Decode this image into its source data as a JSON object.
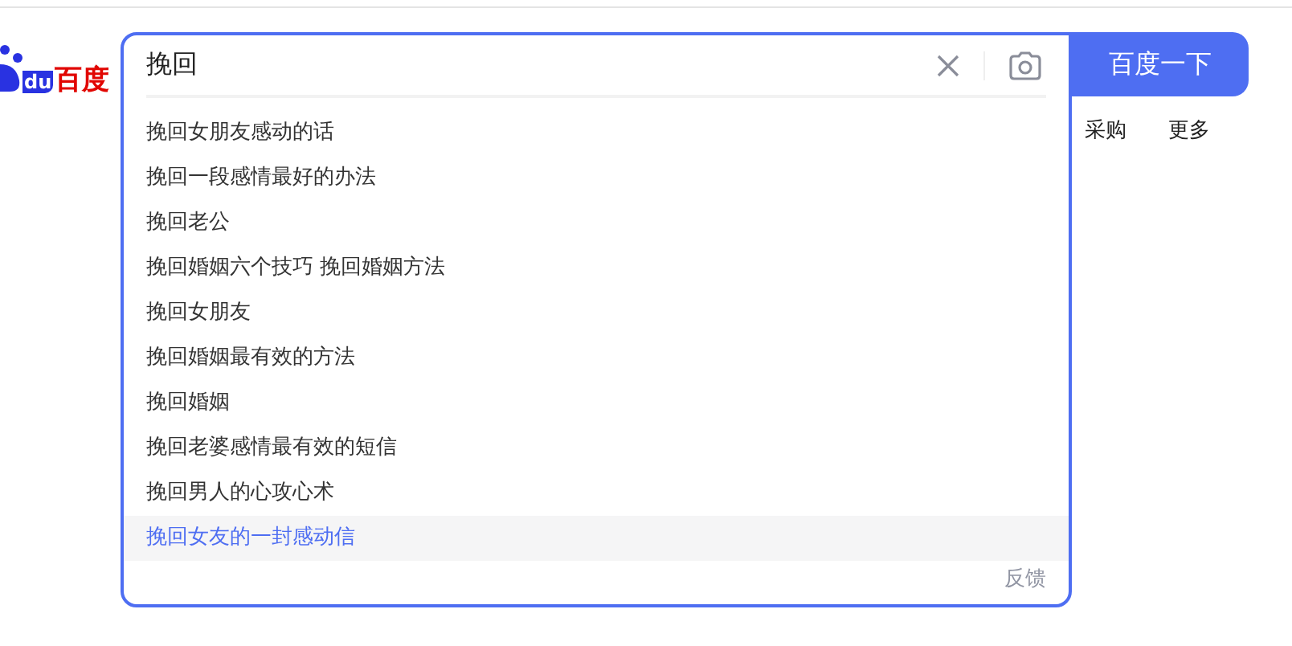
{
  "logo": {
    "mark_text": "du",
    "name": "百度"
  },
  "search": {
    "value": "挽回"
  },
  "suggestions": [
    {
      "text": "挽回女朋友感动的话",
      "selected": false
    },
    {
      "text": "挽回一段感情最好的办法",
      "selected": false
    },
    {
      "text": "挽回老公",
      "selected": false
    },
    {
      "text": "挽回婚姻六个技巧 挽回婚姻方法",
      "selected": false
    },
    {
      "text": "挽回女朋友",
      "selected": false
    },
    {
      "text": "挽回婚姻最有效的方法",
      "selected": false
    },
    {
      "text": "挽回婚姻",
      "selected": false
    },
    {
      "text": "挽回老婆感情最有效的短信",
      "selected": false
    },
    {
      "text": "挽回男人的心攻心术",
      "selected": false
    },
    {
      "text": "挽回女友的一封感动信",
      "selected": true
    }
  ],
  "feedback": "反馈",
  "search_button": "百度一下",
  "nav": [
    "采购",
    "更多"
  ]
}
